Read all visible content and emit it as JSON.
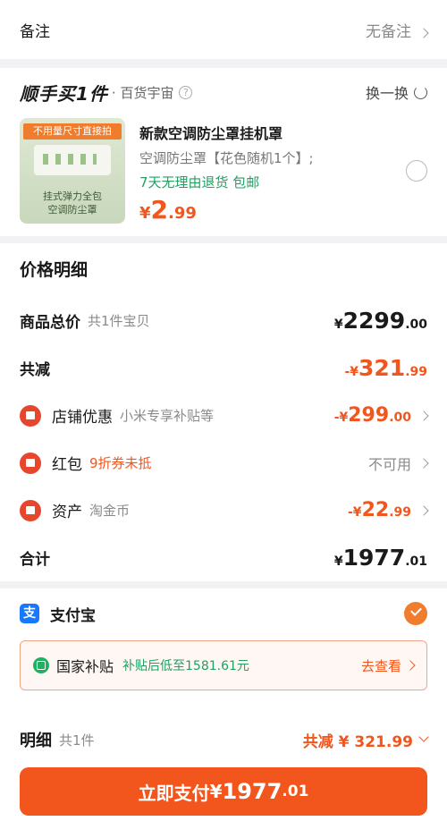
{
  "note": {
    "label": "备注",
    "value": "无备注"
  },
  "shunshou": {
    "brand": "顺手买1件",
    "category": "· 百货宇宙",
    "help_icon": "question-circle-icon",
    "swap_label": "换一换",
    "product": {
      "image_tag": "不用量尺寸直接拍",
      "image_caption_1": "挂式弹力全包",
      "image_caption_2": "空调防尘罩",
      "name": "新款空调防尘罩挂机罩",
      "spec": "空调防尘罩【花色随机1个】;",
      "service": "7天无理由退货  包邮",
      "price_symbol": "¥",
      "price_int": "2",
      "price_dec": ".99"
    }
  },
  "detail": {
    "title": "价格明细",
    "total": {
      "label": "商品总价",
      "sub": "共1件宝贝",
      "sym": "¥",
      "int": "2299",
      "dec": ".00"
    },
    "reduce": {
      "label": "共减",
      "sym": "-¥",
      "int": "321",
      "dec": ".99"
    },
    "shop": {
      "label": "店铺优惠",
      "sub": "小米专享补贴等",
      "sym": "-¥",
      "int": "299",
      "dec": ".00"
    },
    "redpack": {
      "label": "红包",
      "sub": "9折券未抵",
      "value": "不可用"
    },
    "asset": {
      "label": "资产",
      "sub": "淘金币",
      "sym": "-¥",
      "int": "22",
      "dec": ".99"
    },
    "sum": {
      "label": "合计",
      "sym": "¥",
      "int": "1977",
      "dec": ".01"
    }
  },
  "payment": {
    "method": "支付宝",
    "subsidy_label": "国家补贴",
    "subsidy_text": "补贴后低至1581.61元",
    "subsidy_link": "去查看"
  },
  "bottom": {
    "label": "明细",
    "count": "共1件",
    "reduce": "共减 ¥ 321.99",
    "pay_label": "立即支付",
    "pay_sym": "¥",
    "pay_int": "1977",
    "pay_dec": ".01"
  },
  "colors": {
    "accent": "#f2561d",
    "green": "#20a162",
    "alipay": "#1677ff"
  }
}
